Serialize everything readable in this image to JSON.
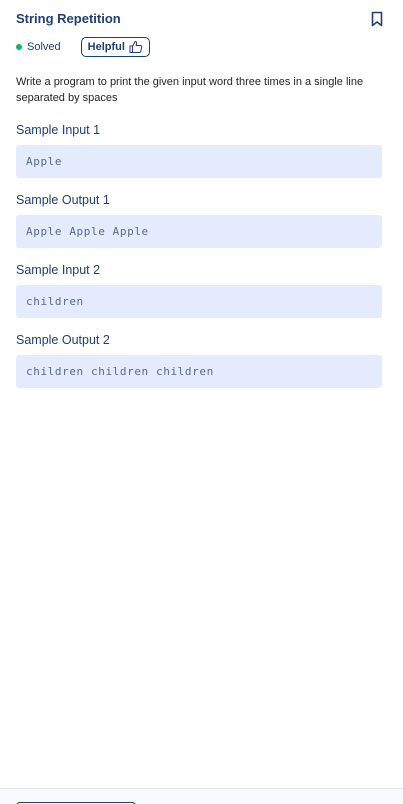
{
  "header": {
    "title": "String Repetition",
    "status": "Solved",
    "helpful_label": "Helpful",
    "colors": {
      "title": "#1f3f77",
      "solved_dot": "#12b76a"
    },
    "icons": {
      "bookmark": "bookmark-icon",
      "thumbs_up": "thumbs-up-icon"
    }
  },
  "description": "Write a program to print the given input word three times in a single line separated by spaces",
  "samples": [
    {
      "label": "Sample Input 1",
      "value": "Apple"
    },
    {
      "label": "Sample Output 1",
      "value": "Apple Apple Apple"
    },
    {
      "label": "Sample Input 2",
      "value": "children"
    },
    {
      "label": "Sample Output 2",
      "value": "children children children"
    }
  ]
}
